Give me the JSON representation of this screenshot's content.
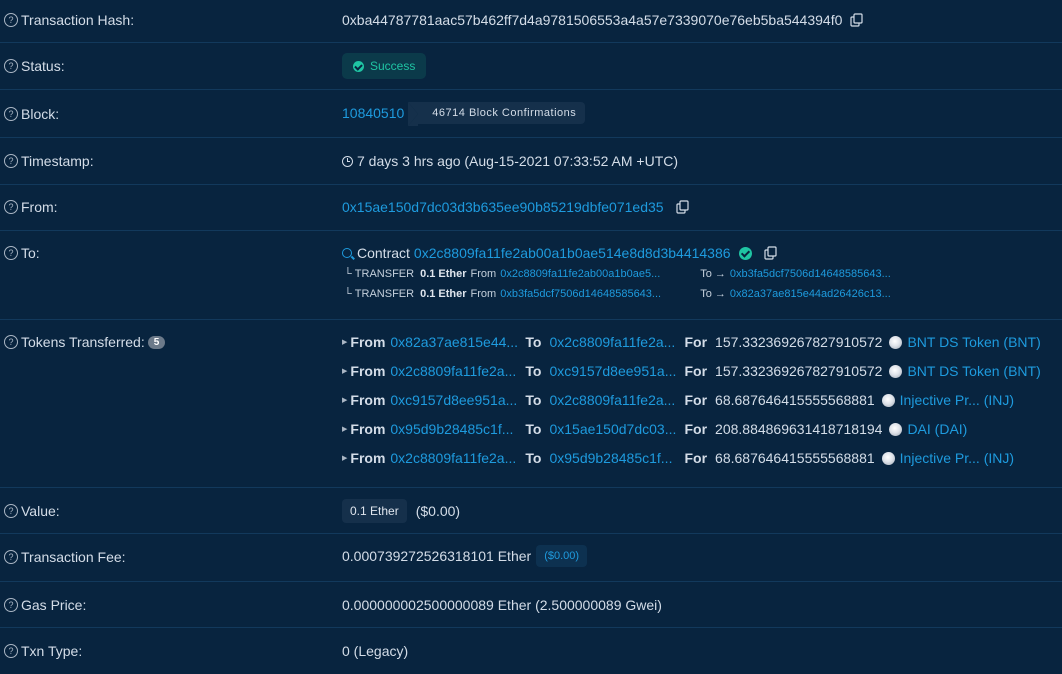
{
  "colors": {
    "background": "#08243f",
    "link": "#1e9bde",
    "success": "#1fc4a3",
    "text": "#d4dde8"
  },
  "tx_hash": {
    "label": "Transaction Hash:",
    "value": "0xba44787781aac57b462ff7d4a9781506553a4a57e7339070e76eb5ba544394f0"
  },
  "status": {
    "label": "Status:",
    "value": "Success"
  },
  "block": {
    "label": "Block:",
    "number": "10840510",
    "confirmations": "46714 Block Confirmations"
  },
  "timestamp": {
    "label": "Timestamp:",
    "value": "7 days 3 hrs ago (Aug-15-2021 07:33:52 AM +UTC)"
  },
  "from": {
    "label": "From:",
    "address": "0x15ae150d7dc03d3b635ee90b85219dbfe071ed35"
  },
  "to": {
    "label": "To:",
    "prefix": "Contract",
    "address": "0x2c8809fa11fe2ab00a1b0ae514e8d8d3b4414386",
    "internal_transfers": [
      {
        "type": "TRANSFER",
        "amount": "0.1 Ether",
        "from_label": "From",
        "from": "0x2c8809fa11fe2ab00a1b0ae5...",
        "to_label": "To →",
        "to": "0xb3fa5dcf7506d14648585643..."
      },
      {
        "type": "TRANSFER",
        "amount": "0.1 Ether",
        "from_label": "From",
        "from": "0xb3fa5dcf7506d14648585643...",
        "to_label": "To →",
        "to": "0x82a37ae815e44ad26426c13..."
      }
    ]
  },
  "tokens_transferred": {
    "label": "Tokens Transferred:",
    "count": "5",
    "from_label": "From",
    "to_label": "To",
    "for_label": "For",
    "items": [
      {
        "from": "0x82a37ae815e44...",
        "to": "0x2c8809fa11fe2a...",
        "amount": "157.332369267827910572",
        "token": "BNT DS Token (BNT)"
      },
      {
        "from": "0x2c8809fa11fe2a...",
        "to": "0xc9157d8ee951a...",
        "amount": "157.332369267827910572",
        "token": "BNT DS Token (BNT)"
      },
      {
        "from": "0xc9157d8ee951a...",
        "to": "0x2c8809fa11fe2a...",
        "amount": "68.687646415555568881",
        "token": "Injective Pr... (INJ)"
      },
      {
        "from": "0x95d9b28485c1f...",
        "to": "0x15ae150d7dc03...",
        "amount": "208.884869631418718194",
        "token": "DAI (DAI)"
      },
      {
        "from": "0x2c8809fa11fe2a...",
        "to": "0x95d9b28485c1f...",
        "amount": "68.687646415555568881",
        "token": "Injective Pr... (INJ)"
      }
    ]
  },
  "value": {
    "label": "Value:",
    "ether": "0.1 Ether",
    "usd": "($0.00)"
  },
  "fee": {
    "label": "Transaction Fee:",
    "value": "0.000739272526318101 Ether",
    "usd": "($0.00)"
  },
  "gas_price": {
    "label": "Gas Price:",
    "value": "0.000000002500000089 Ether (2.500000089 Gwei)"
  },
  "txn_type": {
    "label": "Txn Type:",
    "value": "0 (Legacy)"
  },
  "help_icon_glyph": "?"
}
